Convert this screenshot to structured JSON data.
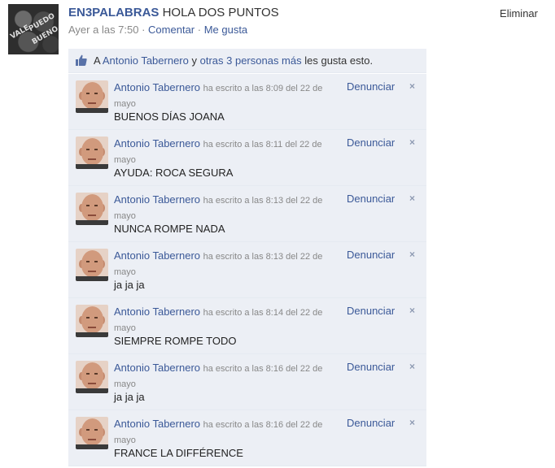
{
  "post": {
    "author": "EN3PALABRAS",
    "message": "HOLA DOS PUNTOS",
    "time": "Ayer a las 7:50",
    "separator": " · ",
    "comment_link": "Comentar",
    "like_link": "Me gusta",
    "delete": "Eliminar",
    "avatar_texts": [
      "VALE",
      "PUEDO",
      "BUENO"
    ]
  },
  "likes": {
    "prefix": "A ",
    "person": "Antonio Tabernero",
    "joiner": " y ",
    "others": "otras 3 personas más",
    "suffix": " les gusta esto."
  },
  "comments": [
    {
      "author": "Antonio Tabernero",
      "meta": "ha escrito a las 8:09 del 22 de mayo",
      "text": "BUENOS DÍAS JOANA",
      "report": "Denunciar",
      "close": "×"
    },
    {
      "author": "Antonio Tabernero",
      "meta": "ha escrito a las 8:11 del 22 de mayo",
      "text": "AYUDA: ROCA SEGURA",
      "report": "Denunciar",
      "close": "×"
    },
    {
      "author": "Antonio Tabernero",
      "meta": "ha escrito a las 8:13 del 22 de mayo",
      "text": "NUNCA ROMPE NADA",
      "report": "Denunciar",
      "close": "×"
    },
    {
      "author": "Antonio Tabernero",
      "meta": "ha escrito a las 8:13 del 22 de mayo",
      "text": "ja ja ja",
      "report": "Denunciar",
      "close": "×"
    },
    {
      "author": "Antonio Tabernero",
      "meta": "ha escrito a las 8:14 del 22 de mayo",
      "text": "SIEMPRE ROMPE TODO",
      "report": "Denunciar",
      "close": "×"
    },
    {
      "author": "Antonio Tabernero",
      "meta": "ha escrito a las 8:16 del 22 de mayo",
      "text": "ja ja ja",
      "report": "Denunciar",
      "close": "×"
    },
    {
      "author": "Antonio Tabernero",
      "meta": "ha escrito a las 8:16 del 22 de mayo",
      "text": "FRANCE LA DIFFÉRENCE",
      "report": "Denunciar",
      "close": "×"
    }
  ],
  "colors": {
    "link": "#3b5998",
    "panel": "#eceff5",
    "meta": "#888888"
  }
}
